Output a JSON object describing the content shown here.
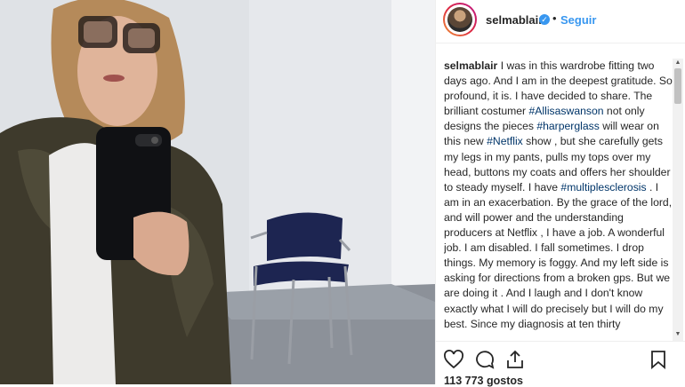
{
  "post": {
    "username": "selmablair",
    "follow_label": "Seguir",
    "separator": "•",
    "verified_glyph": "✓"
  },
  "caption": {
    "username": "selmablair",
    "parts": [
      {
        "t": "I was in this wardrobe fitting two days ago. And I am in the deepest gratitude. So profound, it is. I have decided to share. The brilliant costumer "
      },
      {
        "t": "#Allisaswanson",
        "tag": true
      },
      {
        "t": " not only designs the pieces "
      },
      {
        "t": "#harperglass",
        "tag": true
      },
      {
        "t": " will wear on this new "
      },
      {
        "t": "#Netflix",
        "tag": true
      },
      {
        "t": " show , but she carefully gets my legs in my pants, pulls my tops over my head, buttons my coats and offers her shoulder to steady myself. I have "
      },
      {
        "t": "#multiplesclerosis",
        "tag": true
      },
      {
        "t": " . I am in an exacerbation. By the grace of the lord, and will power and the understanding producers at Netflix , I have a job. A wonderful job. I am disabled. I fall sometimes. I drop things. My memory is foggy. And my left side is asking for directions from a broken gps. But we are doing it . And I laugh and I don't know exactly what I will do precisely but I will do my best. Since my diagnosis at ten thirty "
      }
    ]
  },
  "actions": {
    "like_icon": "heart-icon",
    "comment_icon": "comment-icon",
    "share_icon": "share-icon",
    "save_icon": "bookmark-icon"
  },
  "likes_text": "113 773 gostos",
  "colors": {
    "link": "#3897f0",
    "hashtag": "#003569"
  }
}
